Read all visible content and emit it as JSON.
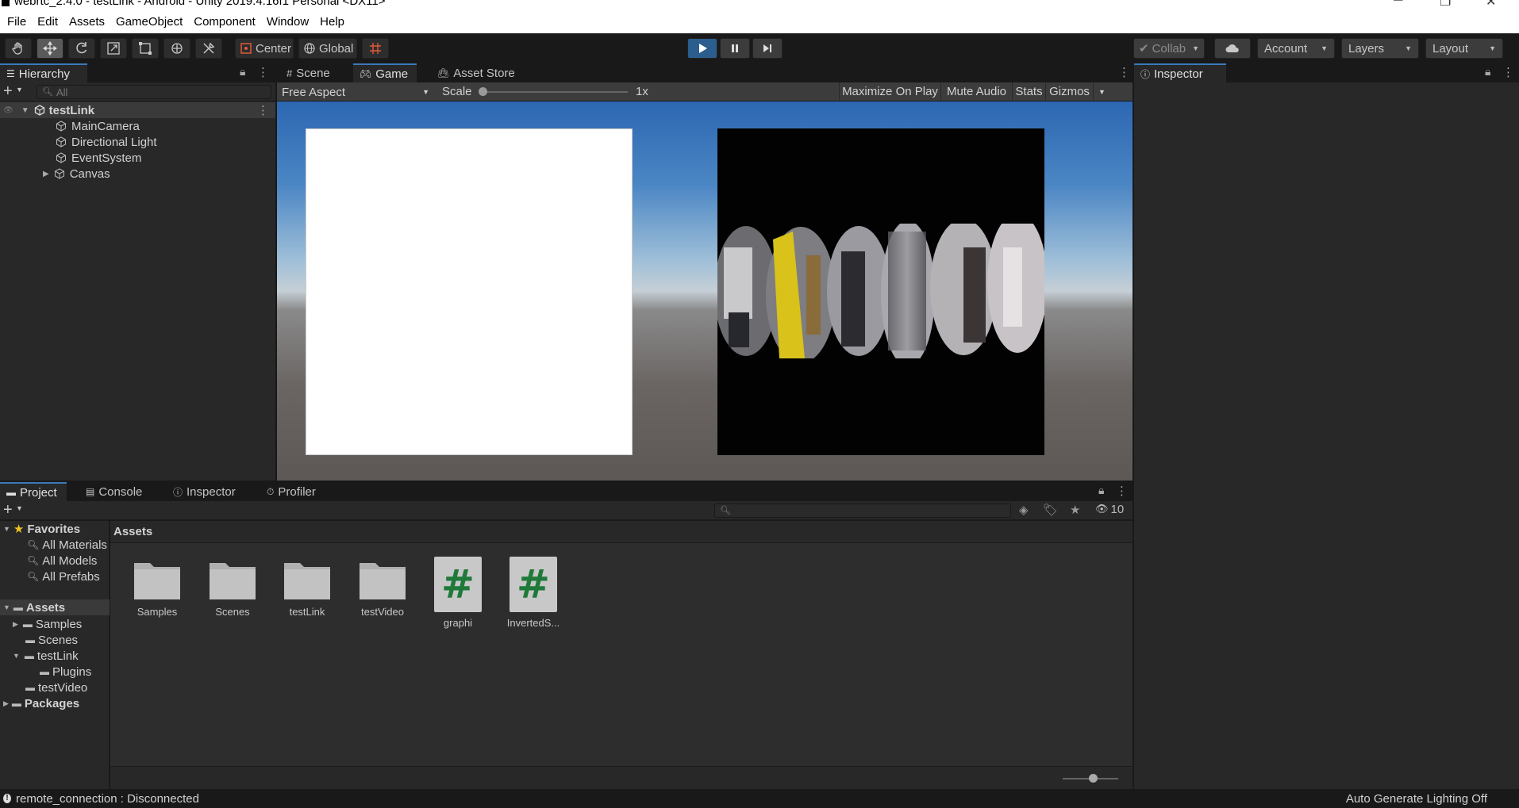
{
  "window": {
    "title": "webrtc_2.4.0 - testLink - Android - Unity 2019.4.16f1 Personal <DX11>"
  },
  "menu": [
    "File",
    "Edit",
    "Assets",
    "GameObject",
    "Component",
    "Window",
    "Help"
  ],
  "toolbar": {
    "tools": [
      "hand-tool-icon",
      "move-tool-icon",
      "rotate-tool-icon",
      "scale-tool-icon",
      "rect-tool-icon",
      "transform-tool-icon",
      "custom-tool-icon"
    ],
    "pivot_label": "Center",
    "space_label": "Global",
    "collab_label": "Collab",
    "account_label": "Account",
    "layers_label": "Layers",
    "layout_label": "Layout"
  },
  "hierarchy": {
    "tab_label": "Hierarchy",
    "search_placeholder": "All",
    "scene": "testLink",
    "objects": [
      "MainCamera",
      "Directional Light",
      "EventSystem",
      "Canvas"
    ]
  },
  "center_tabs": [
    "Scene",
    "Game",
    "Asset Store"
  ],
  "game_view": {
    "aspect": "Free Aspect",
    "scale_label": "Scale",
    "scale_value": "1x",
    "options": [
      "Maximize On Play",
      "Mute Audio",
      "Stats",
      "Gizmos"
    ]
  },
  "inspector": {
    "tab_label": "Inspector"
  },
  "bottom_tabs": [
    "Project",
    "Console",
    "Inspector",
    "Profiler"
  ],
  "project": {
    "hidden_count": "10",
    "breadcrumb": "Assets",
    "favorites_label": "Favorites",
    "favorites": [
      "All Materials",
      "All Models",
      "All Prefabs"
    ],
    "assets_label": "Assets",
    "asset_tree": [
      "Samples",
      "Scenes",
      "testLink",
      "Plugins",
      "testVideo"
    ],
    "packages_label": "Packages",
    "items": [
      {
        "name": "Samples",
        "kind": "folder"
      },
      {
        "name": "Scenes",
        "kind": "folder"
      },
      {
        "name": "testLink",
        "kind": "folder"
      },
      {
        "name": "testVideo",
        "kind": "folder"
      },
      {
        "name": "graphi",
        "kind": "script"
      },
      {
        "name": "InvertedS...",
        "kind": "script"
      }
    ]
  },
  "status": {
    "message": "remote_connection : Disconnected",
    "right": "Auto Generate Lighting Off"
  }
}
